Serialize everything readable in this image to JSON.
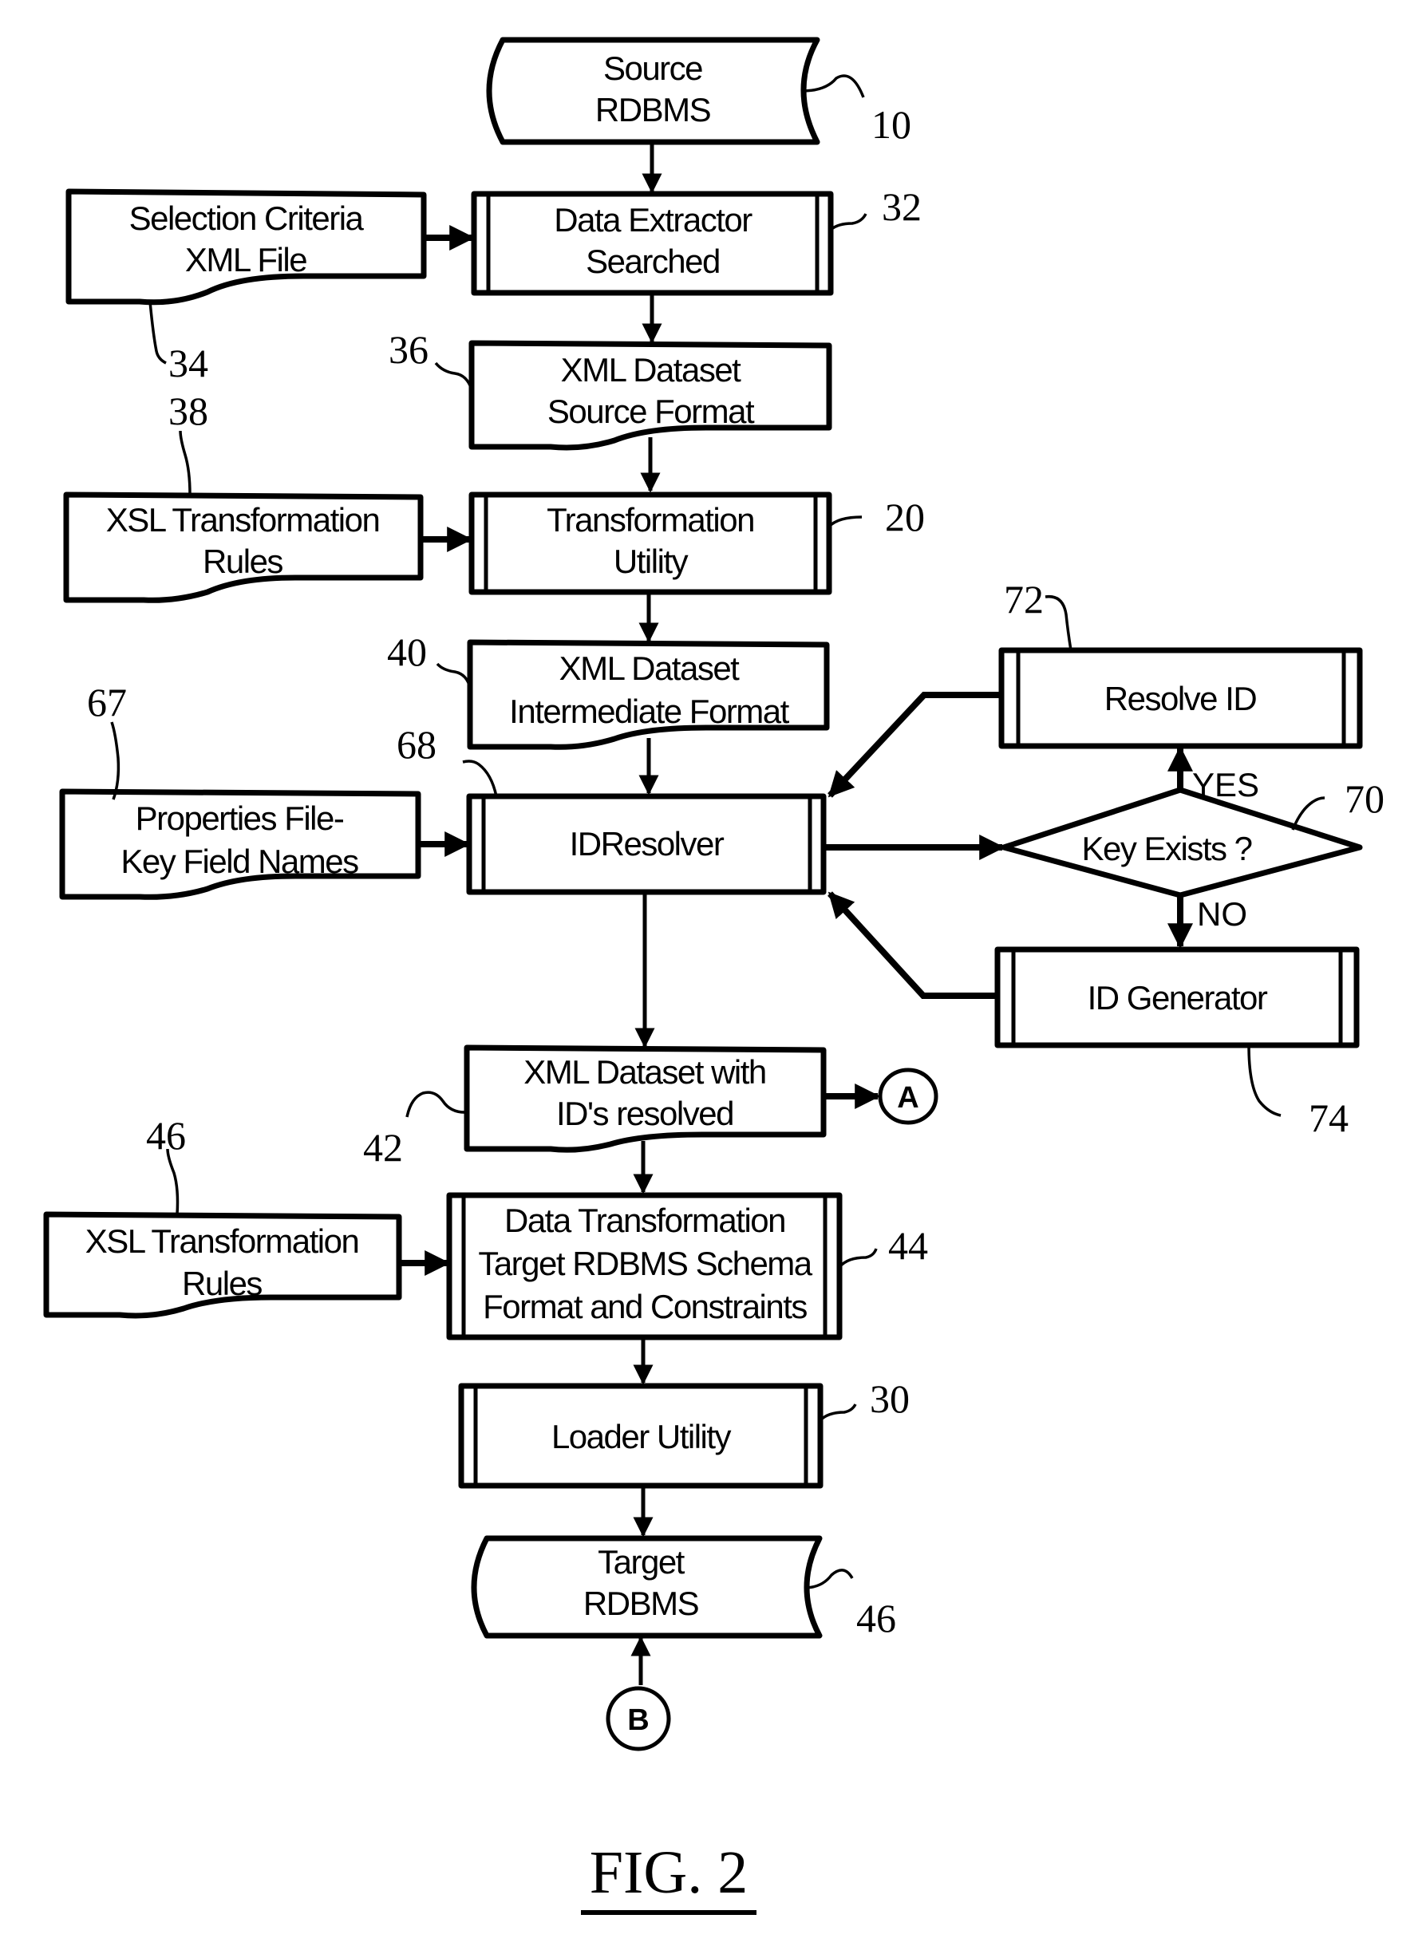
{
  "figure": {
    "caption": "FIG. 2"
  },
  "nodes": {
    "source_rdbms": {
      "ref": "10",
      "type": "database",
      "lines": [
        "Source",
        "RDBMS"
      ]
    },
    "data_extractor": {
      "ref": "32",
      "type": "predefined-process",
      "lines": [
        "Data Extractor",
        "Searched"
      ]
    },
    "selection_criteria": {
      "ref": "34",
      "type": "document",
      "lines": [
        "Selection Criteria",
        "XML File"
      ]
    },
    "xml_source_format": {
      "ref": "36",
      "type": "document",
      "lines": [
        "XML Dataset",
        "Source Format"
      ]
    },
    "xsl_rules_1": {
      "ref": "38",
      "type": "document",
      "lines": [
        "XSL Transformation",
        "Rules"
      ]
    },
    "transformation_utility": {
      "ref": "20",
      "type": "predefined-process",
      "lines": [
        "Transformation",
        "Utility"
      ]
    },
    "xml_intermediate": {
      "ref": "40",
      "type": "document",
      "lines": [
        "XML Dataset",
        "Intermediate Format"
      ]
    },
    "properties_file": {
      "ref": "67",
      "type": "document",
      "lines": [
        "Properties File-",
        "Key Field Names"
      ]
    },
    "id_resolver": {
      "ref": "68",
      "type": "predefined-process",
      "lines": [
        "IDResolver"
      ]
    },
    "resolve_id": {
      "ref": "72",
      "type": "predefined-process",
      "lines": [
        "Resolve ID"
      ]
    },
    "key_exists": {
      "ref": "70",
      "type": "decision",
      "lines": [
        "Key Exists ?"
      ]
    },
    "id_generator": {
      "ref": "74",
      "type": "predefined-process",
      "lines": [
        "ID Generator"
      ]
    },
    "xml_ids_resolved": {
      "ref": "42",
      "type": "document",
      "lines": [
        "XML Dataset with",
        "ID's resolved"
      ]
    },
    "xsl_rules_2": {
      "ref": "46",
      "type": "document",
      "lines": [
        "XSL Transformation",
        "Rules"
      ]
    },
    "data_transformation": {
      "ref": "44",
      "type": "predefined-process",
      "lines": [
        "Data Transformation",
        "Target RDBMS Schema",
        "Format and Constraints"
      ]
    },
    "loader_utility": {
      "ref": "30",
      "type": "predefined-process",
      "lines": [
        "Loader Utility"
      ]
    },
    "target_rdbms": {
      "ref": "46",
      "type": "database",
      "lines": [
        "Target",
        "RDBMS"
      ]
    }
  },
  "connectors": {
    "a": "A",
    "b": "B"
  },
  "branches": {
    "yes": "YES",
    "no": "NO"
  },
  "edges": [
    {
      "from": "source_rdbms",
      "to": "data_extractor"
    },
    {
      "from": "selection_criteria",
      "to": "data_extractor"
    },
    {
      "from": "data_extractor",
      "to": "xml_source_format"
    },
    {
      "from": "xml_source_format",
      "to": "transformation_utility"
    },
    {
      "from": "xsl_rules_1",
      "to": "transformation_utility"
    },
    {
      "from": "transformation_utility",
      "to": "xml_intermediate"
    },
    {
      "from": "xml_intermediate",
      "to": "id_resolver"
    },
    {
      "from": "properties_file",
      "to": "id_resolver"
    },
    {
      "from": "id_resolver",
      "to": "key_exists"
    },
    {
      "from": "key_exists",
      "to": "resolve_id",
      "label": "YES"
    },
    {
      "from": "key_exists",
      "to": "id_generator",
      "label": "NO"
    },
    {
      "from": "resolve_id",
      "to": "id_resolver"
    },
    {
      "from": "id_generator",
      "to": "id_resolver"
    },
    {
      "from": "id_resolver",
      "to": "xml_ids_resolved"
    },
    {
      "from": "xml_ids_resolved",
      "to": "connector_a"
    },
    {
      "from": "xml_ids_resolved",
      "to": "data_transformation"
    },
    {
      "from": "xsl_rules_2",
      "to": "data_transformation"
    },
    {
      "from": "data_transformation",
      "to": "loader_utility"
    },
    {
      "from": "loader_utility",
      "to": "target_rdbms"
    },
    {
      "from": "connector_b",
      "to": "target_rdbms"
    }
  ]
}
